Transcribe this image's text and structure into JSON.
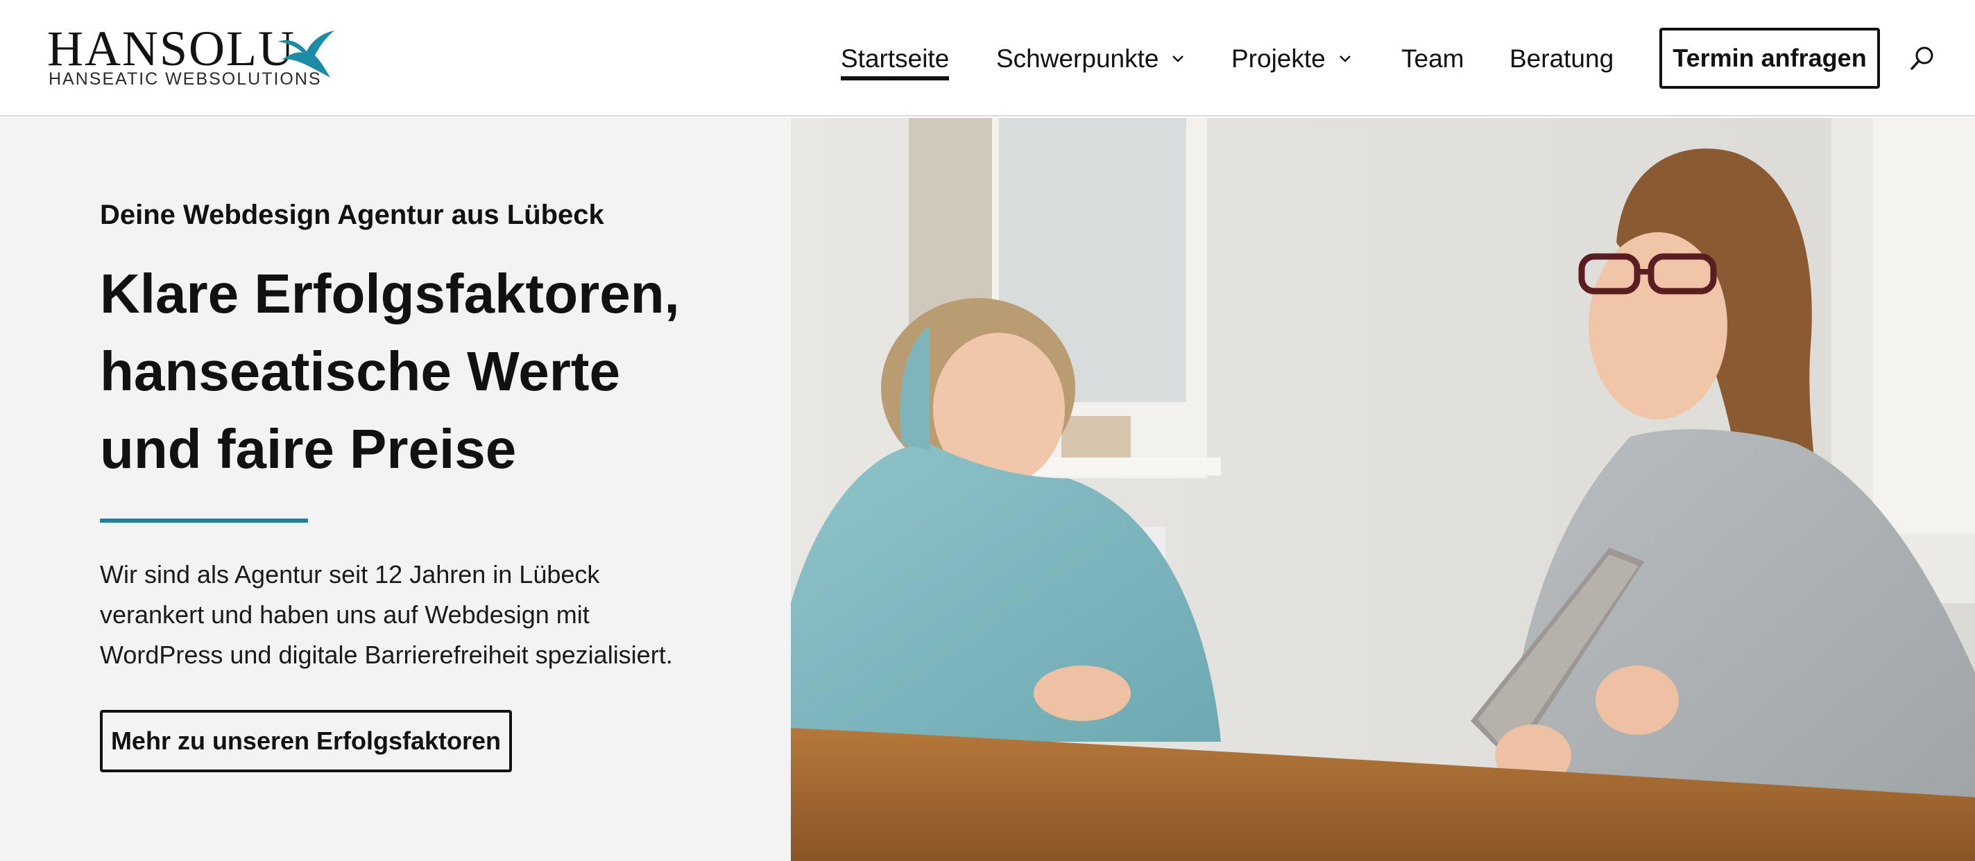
{
  "brand": {
    "name": "HANSOLU",
    "tagline": "HANSEATIC WEBSOLUTIONS",
    "accent_color": "#1f7f9e",
    "bird_color": "#1d8aa6"
  },
  "nav": {
    "items": [
      {
        "label": "Startseite",
        "active": true
      },
      {
        "label": "Schwerpunkte",
        "dropdown": true
      },
      {
        "label": "Projekte",
        "dropdown": true
      },
      {
        "label": "Team"
      },
      {
        "label": "Beratung"
      }
    ],
    "cta_label": "Termin anfragen",
    "search_icon": "search-icon"
  },
  "hero": {
    "kicker": "Deine Webdesign Agentur aus Lübeck",
    "headline_lines": [
      "Klare Erfolgsfaktoren,",
      "hanseatische Werte",
      "und faire Preise"
    ],
    "body_lines": [
      "Wir sind als Agentur seit 12 Jahren in Lübeck",
      "verankert und haben uns auf Webdesign mit",
      "WordPress und digitale Barrierefreiheit spezialisiert."
    ],
    "button_label": "Mehr zu unseren Erfolgsfaktoren",
    "photo": "two-women-at-table-with-tablet-photo"
  }
}
